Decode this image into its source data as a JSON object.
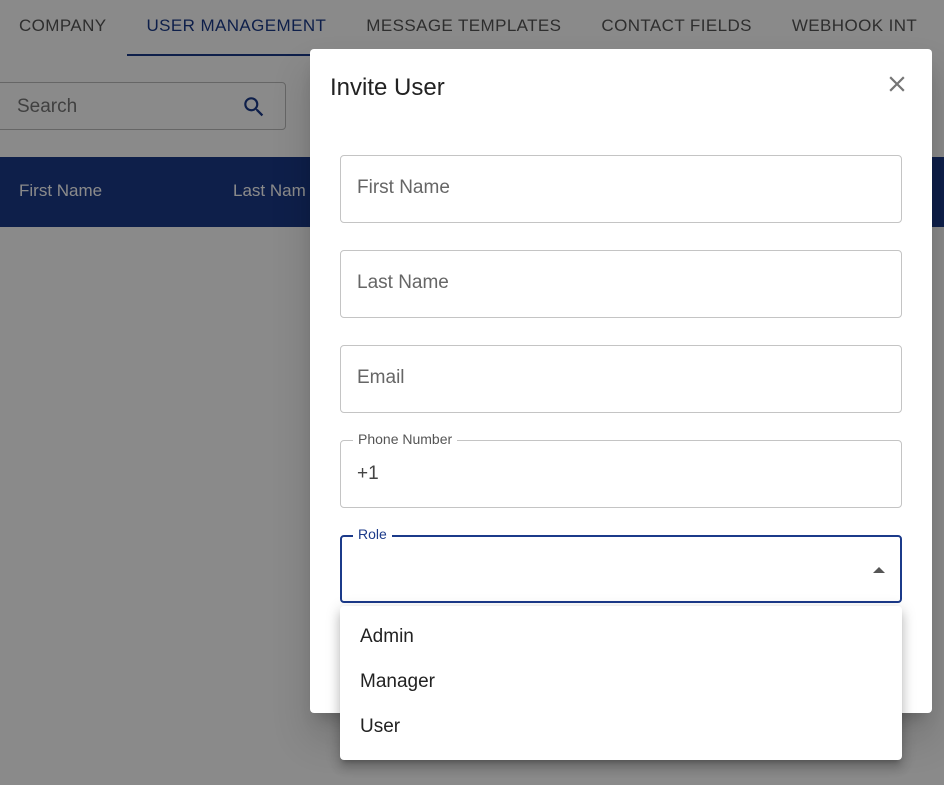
{
  "tabs": [
    {
      "label": "COMPANY"
    },
    {
      "label": "USER MANAGEMENT"
    },
    {
      "label": "MESSAGE TEMPLATES"
    },
    {
      "label": "CONTACT FIELDS"
    },
    {
      "label": "WEBHOOK INT"
    }
  ],
  "active_tab": "USER MANAGEMENT",
  "search": {
    "placeholder": "Search",
    "icon": "search-icon"
  },
  "table": {
    "columns": [
      "First Name",
      "Last Nam"
    ]
  },
  "dialog": {
    "title": "Invite User",
    "close_icon": "close-icon",
    "fields": {
      "first_name": {
        "placeholder": "First Name"
      },
      "last_name": {
        "placeholder": "Last Name"
      },
      "email": {
        "placeholder": "Email"
      },
      "phone": {
        "label": "Phone Number",
        "value": "+1"
      },
      "role": {
        "label": "Role",
        "value": ""
      }
    }
  },
  "role_menu": {
    "options": [
      "Admin",
      "Manager",
      "User"
    ]
  },
  "colors": {
    "primary": "#1b3a8a",
    "overlay": "rgba(0,0,0,0.46)"
  }
}
